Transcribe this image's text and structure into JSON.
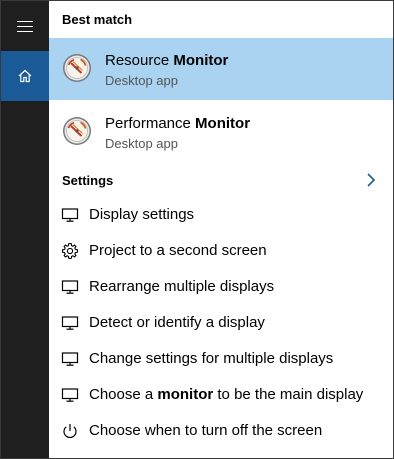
{
  "best_match": {
    "label": "Best match",
    "apps": [
      {
        "name_pre": "Resource ",
        "name_bold": "Monitor",
        "subtitle": "Desktop app",
        "icon": "resource-monitor-icon",
        "selected": true
      },
      {
        "name_pre": "Performance ",
        "name_bold": "Monitor",
        "subtitle": "Desktop app",
        "icon": "performance-monitor-icon",
        "selected": false
      }
    ]
  },
  "settings": {
    "label": "Settings",
    "items": [
      {
        "pre": "Display settings",
        "bold": "",
        "post": "",
        "icon": "monitor-icon"
      },
      {
        "pre": "Project to a second screen",
        "bold": "",
        "post": "",
        "icon": "gear-icon"
      },
      {
        "pre": "Rearrange multiple displays",
        "bold": "",
        "post": "",
        "icon": "monitor-icon"
      },
      {
        "pre": "Detect or identify a display",
        "bold": "",
        "post": "",
        "icon": "monitor-icon"
      },
      {
        "pre": "Change settings for multiple displays",
        "bold": "",
        "post": "",
        "icon": "monitor-icon"
      },
      {
        "pre": "Choose a ",
        "bold": "monitor",
        "post": " to be the main display",
        "icon": "monitor-icon"
      },
      {
        "pre": "Choose when to turn off the screen",
        "bold": "",
        "post": "",
        "icon": "power-icon"
      }
    ]
  },
  "colors": {
    "rail": "#1f1f1f",
    "home_active": "#1a5a97",
    "selected_row": "#a9d3f0",
    "chevron": "#1a5a97"
  }
}
